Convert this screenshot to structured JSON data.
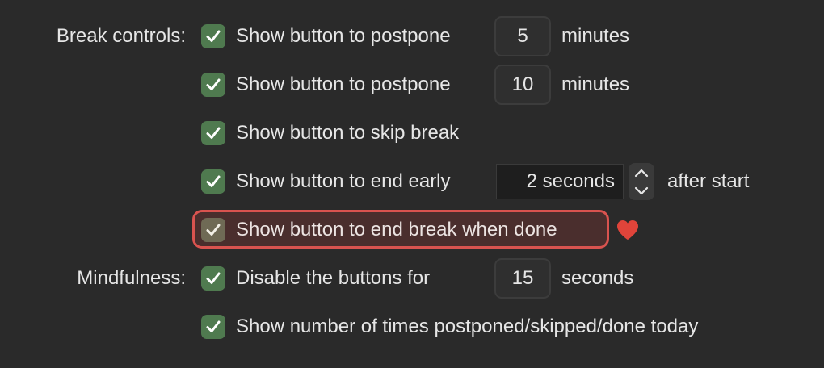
{
  "sections": {
    "break_controls_label": "Break controls:",
    "mindfulness_label": "Mindfulness:"
  },
  "break_controls": {
    "postpone1": {
      "label": "Show button to postpone",
      "value": "5",
      "unit": "minutes",
      "checked": true
    },
    "postpone2": {
      "label": "Show button to postpone",
      "value": "10",
      "unit": "minutes",
      "checked": true
    },
    "skip": {
      "label": "Show button to skip break",
      "checked": true
    },
    "end_early": {
      "label": "Show button to end early",
      "selected": "2 seconds",
      "suffix": "after start",
      "checked": true
    },
    "end_when_done": {
      "label": "Show button to end break when done",
      "checked": true,
      "highlighted": true,
      "highlight_color": "#d9534f",
      "heart_icon": "heart-icon"
    }
  },
  "mindfulness": {
    "disable_buttons": {
      "label": "Disable the buttons for",
      "value": "15",
      "unit": "seconds",
      "checked": true
    },
    "show_counts": {
      "label": "Show number of times postponed/skipped/done today",
      "checked": true
    }
  },
  "colors": {
    "background": "#2a2a2a",
    "checkbox_green": "#4f7a4f",
    "heart_red": "#e0443a"
  }
}
